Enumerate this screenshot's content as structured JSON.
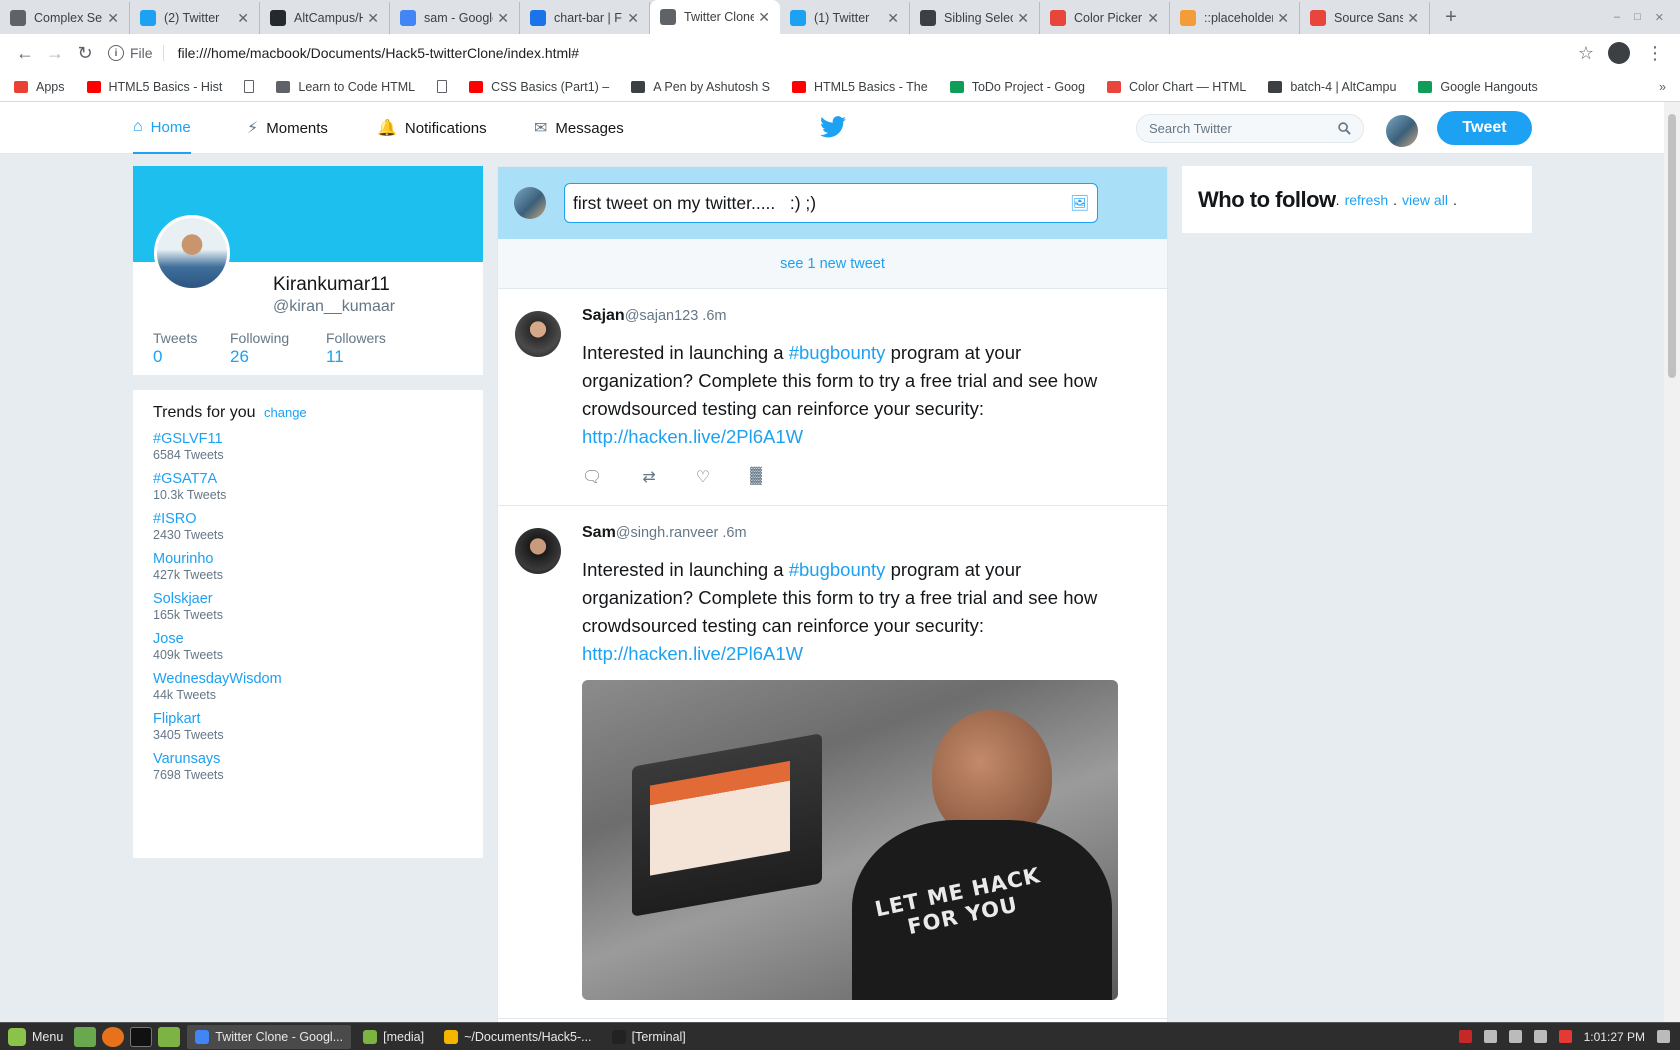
{
  "browser": {
    "tabs": [
      {
        "title": "Complex Sele",
        "icon": "code-icon",
        "color": "#5f6368"
      },
      {
        "title": "(2) Twitter",
        "icon": "twitter-icon",
        "color": "#1da1f2"
      },
      {
        "title": "AltCampus/H",
        "icon": "github-icon",
        "color": "#24292e"
      },
      {
        "title": "sam - Google",
        "icon": "google-icon",
        "color": "#4285f4"
      },
      {
        "title": "chart-bar | F",
        "icon": "bookmark-icon",
        "color": "#1a73e8"
      },
      {
        "title": "Twitter Clone",
        "icon": "file-icon",
        "color": "#5f6368",
        "active": true
      },
      {
        "title": "(1) Twitter",
        "icon": "twitter-icon",
        "color": "#1da1f2"
      },
      {
        "title": "Sibling Select",
        "icon": "codepen-icon",
        "color": "#3c4043"
      },
      {
        "title": "Color Picker",
        "icon": "opera-icon",
        "color": "#e8453c"
      },
      {
        "title": "::placeholder",
        "icon": "asterisk-icon",
        "color": "#f29d38"
      },
      {
        "title": "Source Sans",
        "icon": "font-icon",
        "color": "#e8453c"
      }
    ],
    "address": {
      "scheme": "File",
      "url": "file:///home/macbook/Documents/Hack5-twitterClone/index.html#"
    },
    "bookmarks": [
      {
        "label": "Apps",
        "type": "apps"
      },
      {
        "label": "HTML5 Basics - Hist",
        "type": "youtube"
      },
      {
        "label": "",
        "type": "doc"
      },
      {
        "label": "Learn to Code HTML",
        "type": "code"
      },
      {
        "label": "",
        "type": "doc"
      },
      {
        "label": "CSS Basics (Part1) –",
        "type": "youtube"
      },
      {
        "label": "A Pen by Ashutosh S",
        "type": "codepen"
      },
      {
        "label": "HTML5 Basics - The",
        "type": "youtube"
      },
      {
        "label": "ToDo Project - Goog",
        "type": "drive"
      },
      {
        "label": "Color Chart — HTML",
        "type": "opera"
      },
      {
        "label": "batch-4 | AltCampu",
        "type": "hash"
      },
      {
        "label": "Google Hangouts",
        "type": "hangouts"
      }
    ],
    "bookmarks_more": "»"
  },
  "nav": {
    "items": [
      {
        "label": "Home",
        "icon": "home-icon",
        "active": true
      },
      {
        "label": "Moments",
        "icon": "lightning-icon"
      },
      {
        "label": "Notifications",
        "icon": "bell-icon"
      },
      {
        "label": "Messages",
        "icon": "envelope-icon"
      }
    ],
    "search_placeholder": "Search Twitter",
    "tweet_button": "Tweet"
  },
  "profile": {
    "name": "Kirankumar11",
    "handle": "@kiran__kumaar",
    "stats": [
      {
        "label": "Tweets",
        "value": "0"
      },
      {
        "label": "Following",
        "value": "26"
      },
      {
        "label": "Followers",
        "value": "11"
      }
    ]
  },
  "trends": {
    "title": "Trends for you",
    "change_label": "change",
    "items": [
      {
        "tag": "#GSLVF11",
        "count": "6584 Tweets"
      },
      {
        "tag": "#GSAT7A",
        "count": "10.3k Tweets"
      },
      {
        "tag": "#ISRO",
        "count": "2430 Tweets"
      },
      {
        "tag": "Mourinho",
        "count": "427k Tweets"
      },
      {
        "tag": "Solskjaer",
        "count": "165k Tweets"
      },
      {
        "tag": "Jose",
        "count": "409k Tweets"
      },
      {
        "tag": "WednesdayWisdom",
        "count": "44k Tweets"
      },
      {
        "tag": "Flipkart",
        "count": "3405 Tweets"
      },
      {
        "tag": "Varunsays",
        "count": "7698 Tweets"
      }
    ]
  },
  "composer": {
    "value": "first tweet on my twitter.....   :) ;)"
  },
  "new_tweets_label": "see 1 new tweet",
  "tweets": [
    {
      "name": "Sajan",
      "handle": "@sajan123",
      "time": ".6m",
      "text_before": "Interested in launching a ",
      "hashtag": "#bugbounty",
      "text_after": " program at your organization? Complete this form to try a free trial and see how crowdsourced testing can reinforce your security:",
      "link": "http://hacken.live/2Pl6A1W",
      "has_media": false
    },
    {
      "name": "Sam",
      "handle": "@singh.ranveer",
      "time": ".6m",
      "text_before": "Interested in launching a ",
      "hashtag": "#bugbounty",
      "text_after": " program at your organization? Complete this form to try a free trial and see how crowdsourced testing can reinforce your security:",
      "link": "http://hacken.live/2Pl6A1W",
      "has_media": true,
      "media_text": "LET ME HACK\nFOR YOU"
    }
  ],
  "who_to_follow": {
    "title": "Who to follow",
    "sep": ".",
    "refresh": "refresh",
    "view_all": "view all"
  },
  "taskbar": {
    "menu_label": "Menu",
    "tasks": [
      {
        "label": "Twitter Clone - Googl...",
        "active": true
      },
      {
        "label": "[media]"
      },
      {
        "label": "~/Documents/Hack5-..."
      },
      {
        "label": "[Terminal]"
      }
    ],
    "clock": "1:01:27 PM"
  },
  "colors": {
    "twitter_blue": "#1da1f2",
    "banner": "#1dbfee",
    "composer_bg": "#a9e0f7",
    "page_bg": "#e6ecf0"
  }
}
